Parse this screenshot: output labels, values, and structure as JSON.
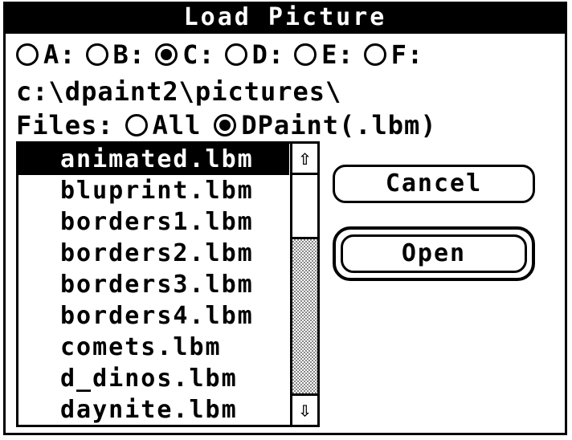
{
  "window": {
    "title": "Load Picture"
  },
  "drives": [
    {
      "label": "A:",
      "selected": false
    },
    {
      "label": "B:",
      "selected": false
    },
    {
      "label": "C:",
      "selected": true
    },
    {
      "label": "D:",
      "selected": false
    },
    {
      "label": "E:",
      "selected": false
    },
    {
      "label": "F:",
      "selected": false
    }
  ],
  "path": "c:\\dpaint2\\pictures\\",
  "filter": {
    "label": "Files:",
    "options": [
      {
        "label": "All",
        "selected": false
      },
      {
        "label": "DPaint(.lbm)",
        "selected": true
      }
    ]
  },
  "file_list": {
    "items": [
      "animated.lbm",
      "bluprint.lbm",
      "borders1.lbm",
      "borders2.lbm",
      "borders3.lbm",
      "borders4.lbm",
      "comets.lbm",
      "d_dinos.lbm",
      "daynite.lbm"
    ],
    "selected_index": 0
  },
  "scrollbar": {
    "up_icon": "up-arrow-icon",
    "down_icon": "down-arrow-icon",
    "up_glyph": "⇧",
    "down_glyph": "⇩"
  },
  "buttons": {
    "cancel": "Cancel",
    "open": "Open"
  }
}
